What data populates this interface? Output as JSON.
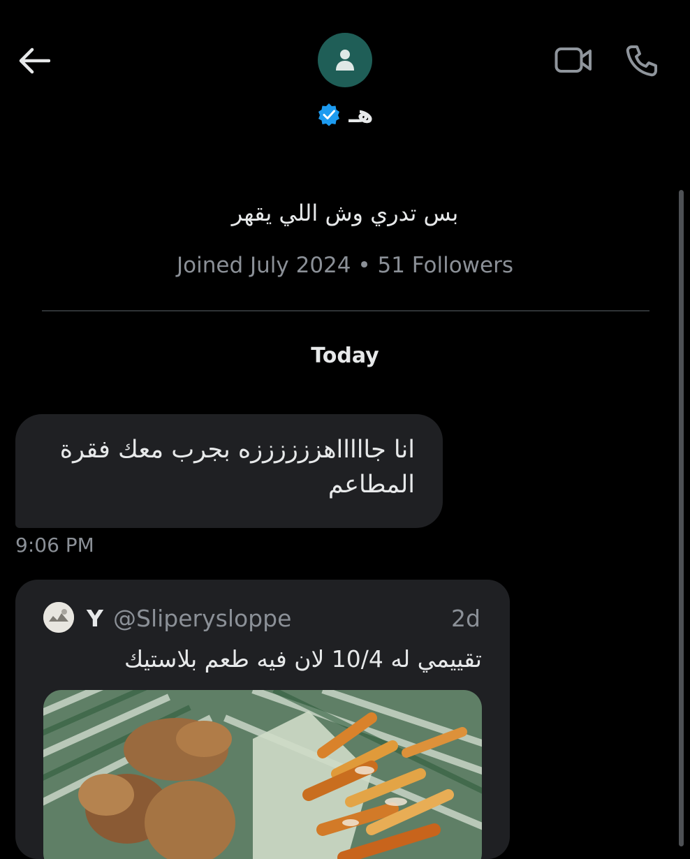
{
  "header": {
    "back_icon": "arrow-left-icon",
    "avatar_icon": "person-icon",
    "display_name": "هـ",
    "verified_icon": "verified-badge-icon",
    "video_icon": "video-camera-icon",
    "call_icon": "phone-icon",
    "avatar_color": "#1f5e57",
    "verified_color": "#1d9bf0"
  },
  "profile": {
    "bio": "بس تدري وش اللي يقهر",
    "meta": "Joined July 2024 • 51 Followers"
  },
  "conversation": {
    "day_label": "Today",
    "messages": [
      {
        "text": "انا جاااااهززززززه بجرب معك فقرة المطاعم",
        "time": "9:06 PM"
      }
    ],
    "shared_post": {
      "author_name": "Y",
      "handle": "@Sliperysloppe",
      "age": "2d",
      "text": "تقييمي له 10/4 لان فيه طعم بلاستيك",
      "media_description_icon": "photo-food-icon"
    }
  },
  "colors": {
    "background": "#000000",
    "bubble": "#1f2023",
    "secondary_text": "#8b9097"
  }
}
